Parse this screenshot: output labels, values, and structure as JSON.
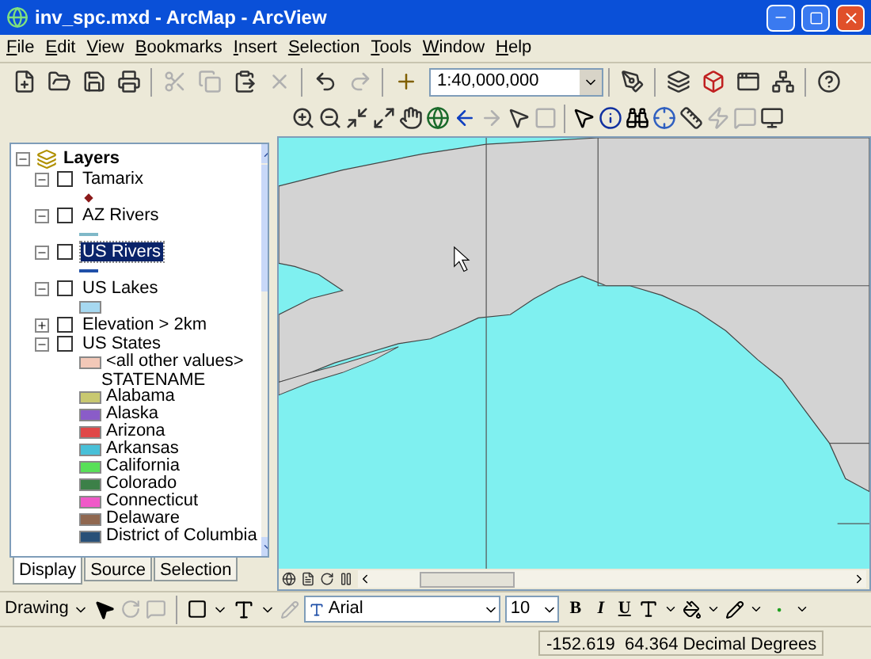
{
  "window": {
    "title": "inv_spc.mxd - ArcMap - ArcView"
  },
  "menu": [
    "File",
    "Edit",
    "View",
    "Bookmarks",
    "Insert",
    "Selection",
    "Tools",
    "Window",
    "Help"
  ],
  "standard_toolbar": {
    "buttons": [
      {
        "disabled": false
      },
      {
        "disabled": false
      },
      {
        "disabled": false
      },
      {
        "disabled": false
      },
      {
        "disabled": true
      },
      {
        "disabled": true
      },
      {
        "disabled": false
      },
      {
        "disabled": true
      },
      {
        "disabled": false
      },
      {
        "disabled": true
      },
      {
        "disabled": false
      }
    ],
    "scale": "1:40,000,000",
    "tools": [
      {
        "disabled": false
      },
      {
        "disabled": false
      },
      {
        "disabled": false
      },
      {
        "disabled": false
      },
      {
        "disabled": false
      },
      {
        "disabled": false
      }
    ]
  },
  "tools_toolbar": {
    "buttons": [
      {
        "disabled": false
      },
      {
        "disabled": false
      },
      {
        "disabled": false
      },
      {
        "disabled": false
      },
      {
        "disabled": false
      },
      {
        "disabled": false
      },
      {
        "disabled": false
      },
      {
        "disabled": true
      },
      {
        "disabled": false
      },
      {
        "disabled": true
      },
      {
        "disabled": false
      },
      {
        "disabled": false
      },
      {
        "disabled": false
      },
      {
        "disabled": false
      },
      {
        "disabled": false
      },
      {
        "disabled": true
      },
      {
        "disabled": true
      },
      {
        "disabled": false
      }
    ]
  },
  "toc": {
    "root": "Layers",
    "layers": [
      {
        "name": "Tamarix",
        "checked": false,
        "expanded": true,
        "selected": false,
        "legend": [
          {
            "kind": "marker",
            "color": "#8b1a1a"
          }
        ]
      },
      {
        "name": "AZ Rivers",
        "checked": false,
        "expanded": true,
        "selected": false,
        "legend": [
          {
            "kind": "line",
            "color": "#7fb8c8"
          }
        ]
      },
      {
        "name": "US Rivers",
        "checked": false,
        "expanded": true,
        "selected": true,
        "legend": [
          {
            "kind": "line",
            "color": "#1f4fa8"
          }
        ]
      },
      {
        "name": "US Lakes",
        "checked": false,
        "expanded": true,
        "selected": false,
        "legend": [
          {
            "kind": "fill",
            "color": "#a6d8f0"
          }
        ]
      },
      {
        "name": "Elevation > 2km",
        "checked": false,
        "expanded": false,
        "selected": false
      },
      {
        "name": "US States",
        "checked": false,
        "expanded": true,
        "selected": false,
        "legend": [
          {
            "kind": "fill",
            "color": "#f2c8b8",
            "label": "<all other values>"
          },
          {
            "kind": "heading",
            "label": "STATENAME"
          },
          {
            "kind": "fill",
            "color": "#c8c870",
            "label": "Alabama"
          },
          {
            "kind": "fill",
            "color": "#8a5cc8",
            "label": "Alaska"
          },
          {
            "kind": "fill",
            "color": "#e04848",
            "label": "Arizona"
          },
          {
            "kind": "fill",
            "color": "#48c0d8",
            "label": "Arkansas"
          },
          {
            "kind": "fill",
            "color": "#58e058",
            "label": "California"
          },
          {
            "kind": "fill",
            "color": "#3c8048",
            "label": "Colorado"
          },
          {
            "kind": "fill",
            "color": "#f058c8",
            "label": "Connecticut"
          },
          {
            "kind": "fill",
            "color": "#906850",
            "label": "Delaware"
          },
          {
            "kind": "fill",
            "color": "#285078",
            "label": "District of Columbia"
          }
        ]
      }
    ],
    "tabs": [
      {
        "label": "Display",
        "selected": true
      },
      {
        "label": "Source",
        "selected": false
      },
      {
        "label": "Selection",
        "selected": false
      }
    ]
  },
  "drawing_toolbar": {
    "menu": "Drawing",
    "font": "Arial",
    "size": "10",
    "bold": "B",
    "italic": "I",
    "underline": "U"
  },
  "status_bar": {
    "coordinates": "-152.619  64.364 Decimal Degrees"
  }
}
